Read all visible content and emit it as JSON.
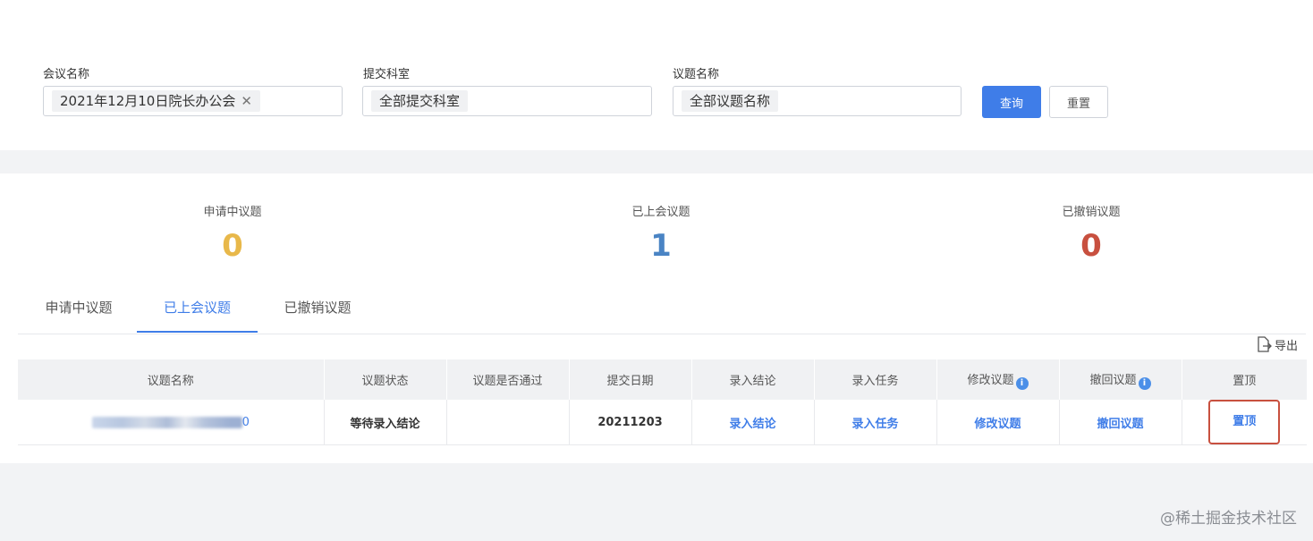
{
  "filters": {
    "meeting": {
      "label": "会议名称",
      "value": "2021年12月10日院长办公会"
    },
    "department": {
      "label": "提交科室",
      "value": "全部提交科室"
    },
    "topic": {
      "label": "议题名称",
      "value": "全部议题名称"
    },
    "query_label": "查询",
    "reset_label": "重置"
  },
  "stats": [
    {
      "label": "申请中议题",
      "value": "0",
      "color": "#e8b84a"
    },
    {
      "label": "已上会议题",
      "value": "1",
      "color": "#4a84c4"
    },
    {
      "label": "已撤销议题",
      "value": "0",
      "color": "#c8503f"
    }
  ],
  "tabs": [
    {
      "label": "申请中议题",
      "active": false
    },
    {
      "label": "已上会议题",
      "active": true
    },
    {
      "label": "已撤销议题",
      "active": false
    }
  ],
  "export_label": "导出",
  "table": {
    "columns": [
      "议题名称",
      "议题状态",
      "议题是否通过",
      "提交日期",
      "录入结论",
      "录入任务",
      "修改议题",
      "撤回议题",
      "置顶"
    ],
    "rows": [
      {
        "name_suffix": "0",
        "status": "等待录入结论",
        "passed": "",
        "date": "20211203",
        "conclusion": "录入结论",
        "task": "录入任务",
        "modify": "修改议题",
        "withdraw": "撤回议题",
        "pin": "置顶"
      }
    ]
  },
  "watermark": "@稀土掘金技术社区"
}
